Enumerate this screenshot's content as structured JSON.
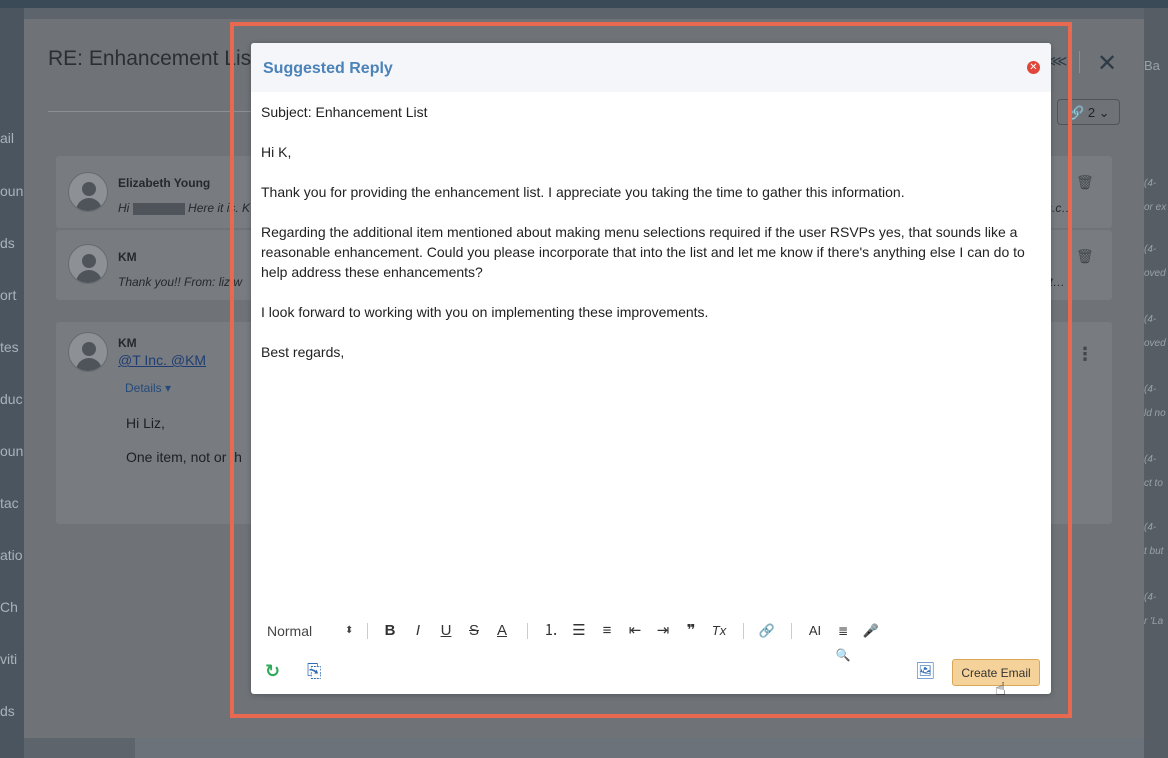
{
  "background": {
    "sidebar_items": [
      "ail",
      "oun",
      "ds",
      "ort",
      "tes",
      "duc",
      "oun",
      "tac",
      "atio",
      "Ch",
      "viti",
      "ds"
    ],
    "right_snippets": [
      "(4-",
      "or ex",
      "(4-",
      "oved",
      "(4-",
      "oved",
      "(4-",
      "ld no",
      "(4-",
      "ct to",
      "(4-",
      "t but",
      "(4-",
      "r 'La"
    ],
    "top_right_text": "Ba"
  },
  "panel": {
    "title": "RE: Enhancement Lis",
    "close_glyph": "✕",
    "share_glyph": "⋘",
    "attachments": {
      "glyph": "🔗",
      "count": "2",
      "chevron": "⌄"
    }
  },
  "threads": [
    {
      "sender": "Elizabeth Young",
      "snippet_pre": "Hi",
      "snippet_post": "Here it is. K",
      "right_text": "sales.c…"
    },
    {
      "sender": "KM",
      "snippet_pre": "Thank you!! From: liz.w",
      "right_text": "ng@t…"
    },
    {
      "sender": "KM",
      "mentions": "@T Inc. @KM",
      "details_label": "Details ▾",
      "body_line1": "Hi Liz,",
      "body_line2": "One item, not or th"
    }
  ],
  "modal": {
    "title": "Suggested Reply",
    "close_glyph": "✕",
    "subject": "Subject: Enhancement List",
    "greeting": "Hi K,",
    "para1": "Thank you for providing the enhancement list. I appreciate you taking the time to gather this information.",
    "para2": "Regarding the additional item mentioned about making menu selections required if the user RSVPs yes, that sounds like a reasonable enhancement. Could you please incorporate that into the list and let me know if there's anything else I can do to help address these enhancements?",
    "para3": "I look forward to working with you on implementing these improvements.",
    "closing": "Best regards,"
  },
  "toolbar": {
    "format_select": "Normal",
    "format_arrows": "⬍",
    "bold": "B",
    "italic": "I",
    "underline": "U",
    "strike": "S",
    "text_color": "A",
    "ordered_list": "⒈",
    "bullet_list": "☰",
    "align": "≡",
    "outdent": "⇤",
    "indent": "⇥",
    "quote": "❞",
    "clear_format": "Tx",
    "link": "🔗",
    "ai": "AI",
    "search_ai": "≣🔍",
    "mic": "🎤"
  },
  "footer": {
    "refresh_glyph": "↻",
    "copy_glyph": "⎘",
    "image_edit_glyph": "🖼",
    "create_email_label": "Create Email",
    "cursor_glyph": "☝"
  },
  "colors": {
    "highlight_border": "#e8694f",
    "modal_title": "#4b82b8",
    "close_red": "#e0463a",
    "create_button_bg": "#f5d29a"
  }
}
